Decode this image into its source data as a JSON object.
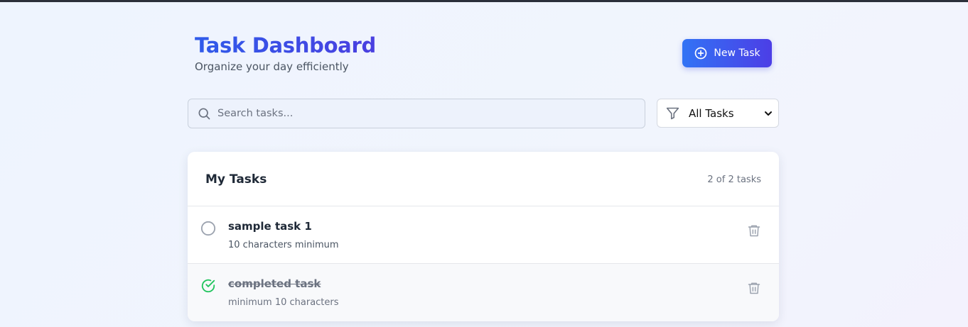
{
  "header": {
    "title": "Task Dashboard",
    "subtitle": "Organize your day efficiently",
    "new_task_label": "New Task"
  },
  "search": {
    "placeholder": "Search tasks..."
  },
  "filter": {
    "selected": "All Tasks",
    "options": [
      "All Tasks"
    ]
  },
  "tasks_card": {
    "title": "My Tasks",
    "count_label": "2 of 2 tasks",
    "tasks": [
      {
        "title": "sample task 1",
        "description": "10 characters minimum",
        "completed": false
      },
      {
        "title": "completed task",
        "description": "minimum 10 characters",
        "completed": true
      }
    ]
  },
  "colors": {
    "accent_start": "#3273f5",
    "accent_end": "#4c3ee6",
    "complete_green": "#22c55e"
  },
  "icons": {
    "new_task": "plus-circle-icon",
    "search": "search-icon",
    "filter": "filter-icon",
    "pending": "circle-icon",
    "completed": "check-circle-icon",
    "delete": "trash-icon"
  }
}
